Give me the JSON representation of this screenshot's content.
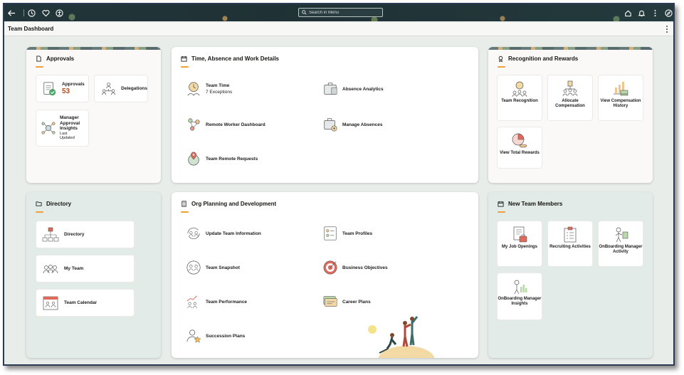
{
  "topbar": {
    "search_placeholder": "Search in Menu"
  },
  "header": {
    "title": "Team Dashboard"
  },
  "cards": {
    "approvals": {
      "title": "Approvals",
      "tiles": {
        "approvals": {
          "label": "Approvals",
          "count": "53"
        },
        "delegations": {
          "label": "Delegations"
        },
        "insights": {
          "label": "Manager Approval Insights",
          "sub": "Last Updated"
        }
      }
    },
    "time": {
      "title": "Time, Absence and Work Details",
      "items": {
        "team_time": {
          "label": "Team Time",
          "sub": "7 Exceptions"
        },
        "absence_analytics": {
          "label": "Absence Analytics"
        },
        "remote_worker": {
          "label": "Remote Worker Dashboard"
        },
        "manage_absences": {
          "label": "Manage Absences"
        },
        "team_remote": {
          "label": "Team Remote Requests"
        }
      }
    },
    "recognition": {
      "title": "Recognition and Rewards",
      "tiles": {
        "team_recognition": {
          "label": "Team Recognition"
        },
        "allocate_compensation": {
          "label": "Allocate Compensation"
        },
        "view_compensation_history": {
          "label": "View Compensation History"
        },
        "view_total_rewards": {
          "label": "View Total Rewards"
        }
      }
    },
    "directory": {
      "title": "Directory",
      "tiles": {
        "directory": {
          "label": "Directory"
        },
        "my_team": {
          "label": "My Team"
        },
        "team_calendar": {
          "label": "Team Calendar"
        }
      }
    },
    "org": {
      "title": "Org Planning and Development",
      "items": {
        "update_team_info": {
          "label": "Update Team Information"
        },
        "team_profiles": {
          "label": "Team Profiles"
        },
        "team_snapshot": {
          "label": "Team Snapshot"
        },
        "business_objectives": {
          "label": "Business Objectives"
        },
        "team_performance": {
          "label": "Team Performance"
        },
        "career_plans": {
          "label": "Career Plans"
        },
        "succession_plans": {
          "label": "Succession Plans"
        }
      }
    },
    "new_members": {
      "title": "New Team Members",
      "tiles": {
        "my_job_openings": {
          "label": "My Job Openings"
        },
        "recruiting_activities": {
          "label": "Recruiting Activities"
        },
        "onboarding_manager_activity": {
          "label": "OnBoarding Manager Activity"
        },
        "onboarding_manager_insights": {
          "label": "OnBoarding Manager Insights"
        }
      }
    }
  },
  "colors": {
    "accent": "#f0a03b",
    "count": "#b04a1c",
    "topbar": "#22363a"
  }
}
